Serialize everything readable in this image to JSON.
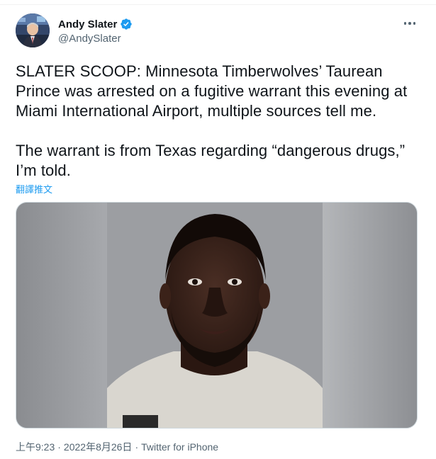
{
  "author": {
    "display_name": "Andy Slater",
    "handle": "@AndySlater",
    "verified": true,
    "verified_color": "#1d9bf0"
  },
  "tweet": {
    "paragraphs": [
      "SLATER SCOOP: Minnesota Timberwolves’ Taurean Prince was arrested on a fugitive warrant this evening at Miami International Airport, multiple sources tell me.",
      "The warrant is from Texas regarding “dangerous drugs,” I’m told."
    ],
    "translate_label": "翻譯推文"
  },
  "media": {
    "icon": "photo"
  },
  "meta": {
    "time": "上午9:23",
    "date": "2022年8月26日",
    "separator": "·",
    "source": "Twitter for iPhone"
  },
  "colors": {
    "text": "#0f1419",
    "secondary": "#536471",
    "accent": "#1d9bf0"
  }
}
